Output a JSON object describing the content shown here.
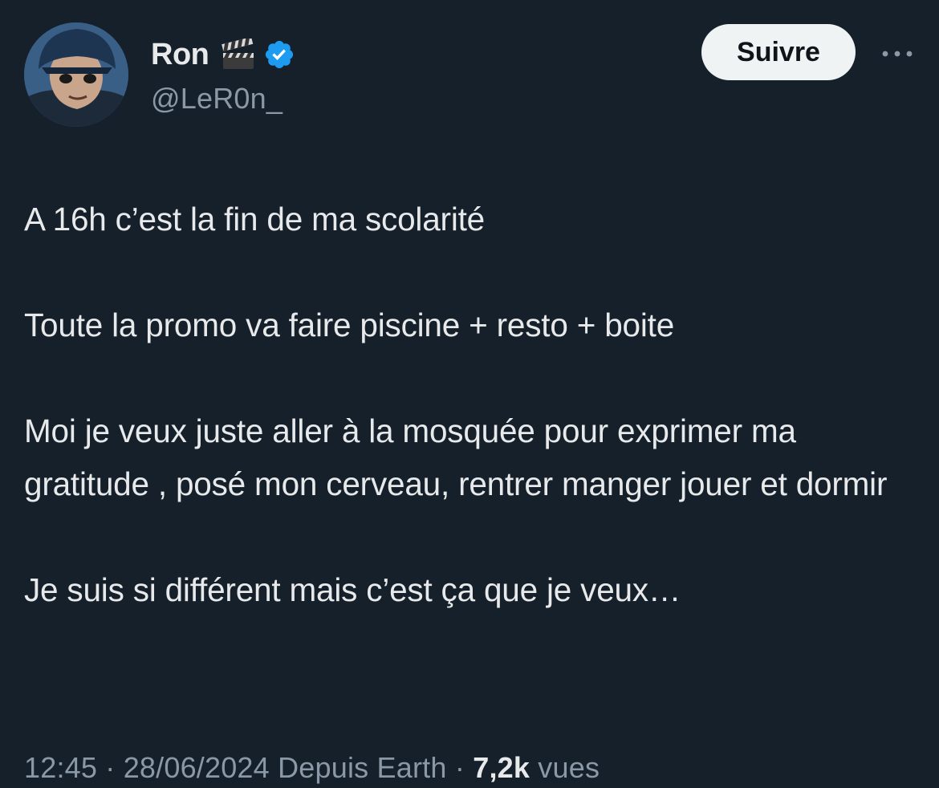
{
  "author": {
    "display_name": "Ron",
    "handle": "@LeR0n_",
    "emoji_icon": "clapperboard-icon",
    "verified_icon": "verified-badge-icon"
  },
  "actions": {
    "follow_label": "Suivre",
    "more_icon": "more-horizontal-icon"
  },
  "tweet": {
    "paragraphs": [
      "A 16h c’est la fin de ma scolarité",
      "Toute la promo va faire piscine + resto + boite",
      "Moi je veux juste aller à la mosquée pour exprimer ma gratitude , posé mon cerveau, rentrer manger jouer et dormir",
      "Je suis si différent mais c’est ça que je veux…"
    ]
  },
  "meta": {
    "time": "12:45",
    "separator": "·",
    "date": "28/06/2024",
    "source": "Depuis Earth",
    "views_count": "7,2k",
    "views_label": "vues"
  },
  "colors": {
    "background": "#15202b",
    "text_primary": "#e7e9ea",
    "text_secondary": "#8b98a5",
    "verified_blue": "#1d9bf0",
    "button_bg": "#eff3f4"
  }
}
